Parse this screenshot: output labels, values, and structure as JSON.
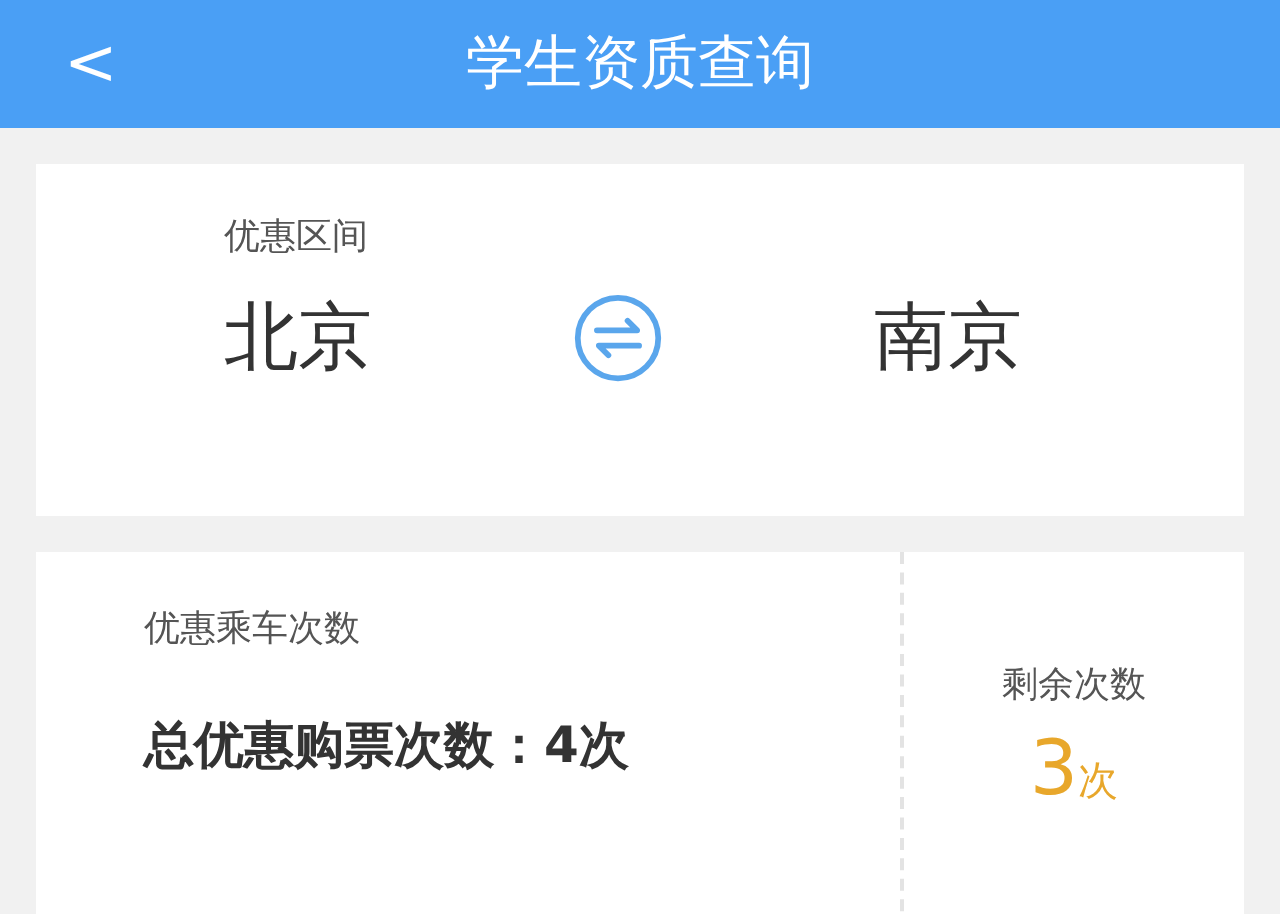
{
  "header": {
    "back": "<",
    "title": "学生资质查询"
  },
  "route": {
    "label": "优惠区间",
    "from": "北京",
    "to": "南京"
  },
  "trips": {
    "label": "优惠乘车次数",
    "total": "总优惠购票次数：4次",
    "remaining_label": "剩余次数",
    "remaining_count": "3",
    "remaining_unit": "次"
  }
}
